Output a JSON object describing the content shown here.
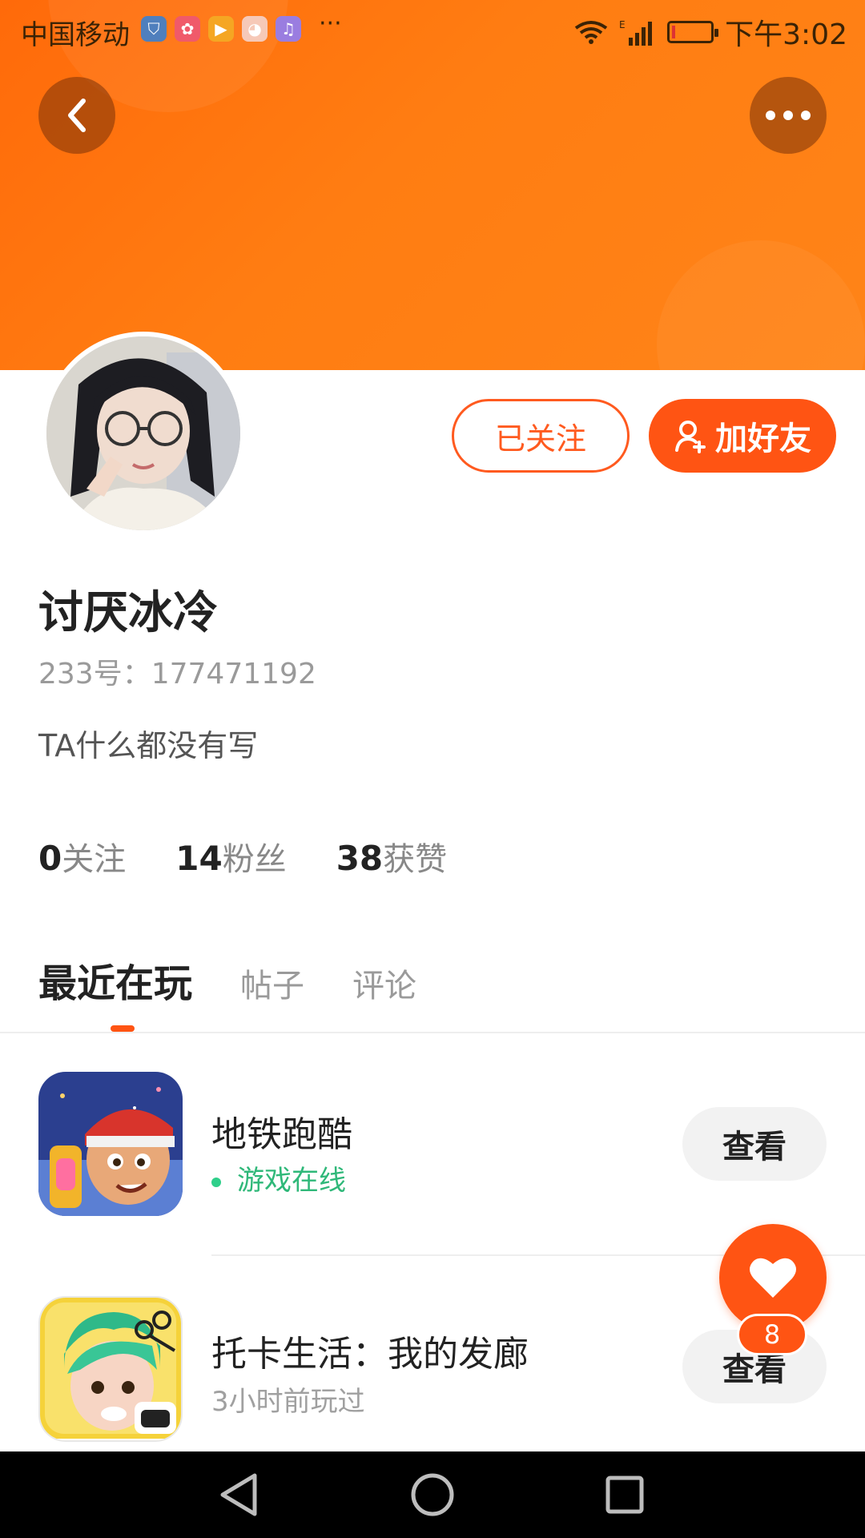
{
  "status_bar": {
    "carrier": "中国移动",
    "more": "···",
    "time": "下午3:02"
  },
  "header": {
    "back_icon": "back-arrow-icon",
    "more_icon": "more-dots-icon",
    "gradient_colors": [
      "#ff6a0a",
      "#ff8418"
    ]
  },
  "profile": {
    "username": "讨厌冰冷",
    "uid": "233号：177471192",
    "bio": "TA什么都没有写",
    "follow_button": "已关注",
    "add_friend_button": "加好友"
  },
  "stats": [
    {
      "value": "0",
      "label": "关注"
    },
    {
      "value": "14",
      "label": "粉丝"
    },
    {
      "value": "38",
      "label": "获赞"
    }
  ],
  "tabs": {
    "active": "最近在玩",
    "items": [
      "帖子",
      "评论"
    ]
  },
  "games": [
    {
      "title": "地铁跑酷",
      "status": "游戏在线",
      "status_color": "#2fb879",
      "action": "查看"
    },
    {
      "title": "托卡生活：我的发廊",
      "status": "3小时前玩过",
      "status_color": "#a0a0a0",
      "action": "查看"
    }
  ],
  "like_fab": {
    "count": "8",
    "icon": "heart-icon"
  },
  "accent_color": "#ff5413"
}
